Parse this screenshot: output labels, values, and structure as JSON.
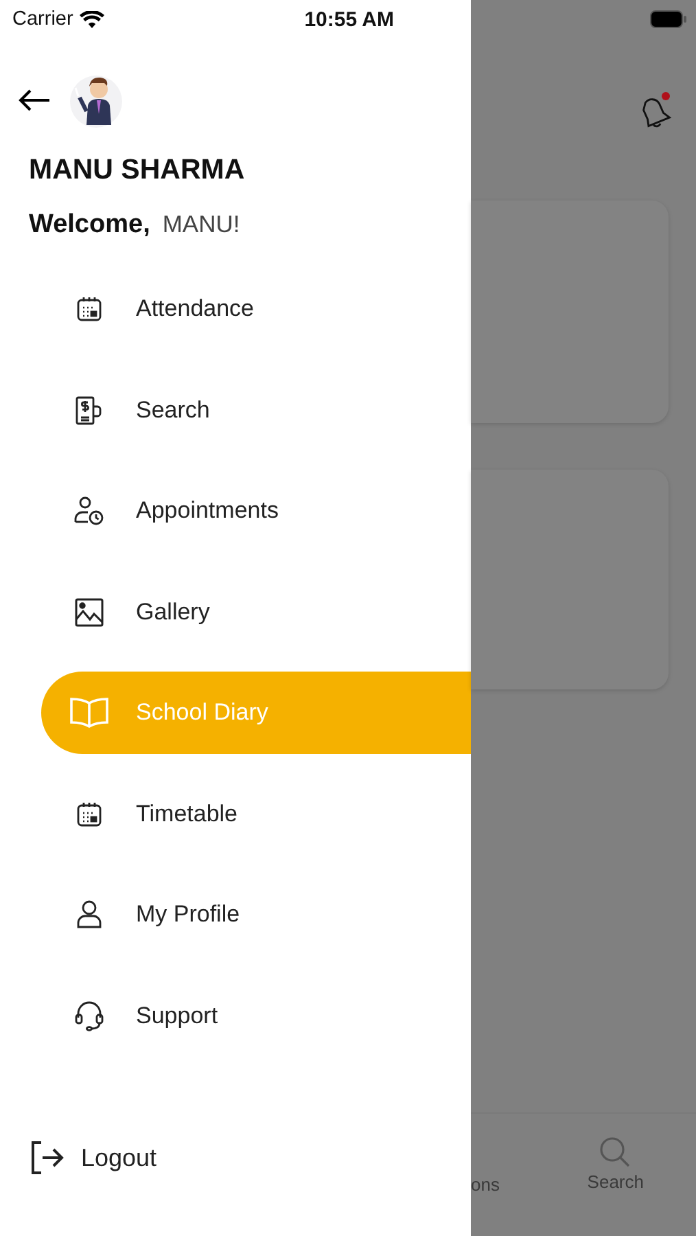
{
  "status_bar": {
    "carrier": "Carrier",
    "time": "10:55 AM"
  },
  "drawer": {
    "name": "MANU SHARMA",
    "welcome": "Welcome,",
    "user": "MANU!",
    "items": [
      {
        "label": "Attendance",
        "selected": false
      },
      {
        "label": "Search",
        "selected": false
      },
      {
        "label": "Appointments",
        "selected": false
      },
      {
        "label": "Gallery",
        "selected": false
      },
      {
        "label": "School Diary",
        "selected": true
      },
      {
        "label": "Timetable",
        "selected": false
      },
      {
        "label": "My Profile",
        "selected": false
      },
      {
        "label": "Support",
        "selected": false
      }
    ],
    "logout": "Logout"
  },
  "background_page": {
    "notification_unread": true,
    "bottom_nav": [
      {
        "label": "ons"
      },
      {
        "label": "Search"
      }
    ]
  }
}
